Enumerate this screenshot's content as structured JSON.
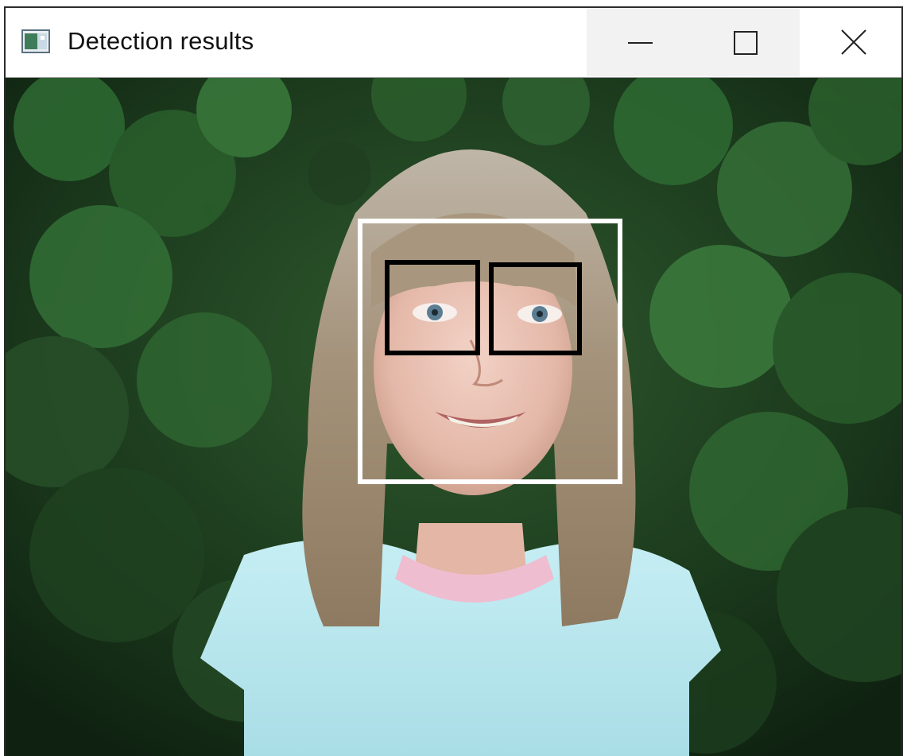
{
  "window": {
    "title": "Detection results",
    "icon": "window-image-icon"
  },
  "controls": {
    "minimize_icon": "minimize-icon",
    "maximize_icon": "maximize-icon",
    "close_icon": "close-icon"
  },
  "image": {
    "description_icon": "photo-canvas",
    "face_box_color": "#ffffff",
    "eye_box_color": "#000000",
    "face_count": 1,
    "eye_count": 2
  }
}
